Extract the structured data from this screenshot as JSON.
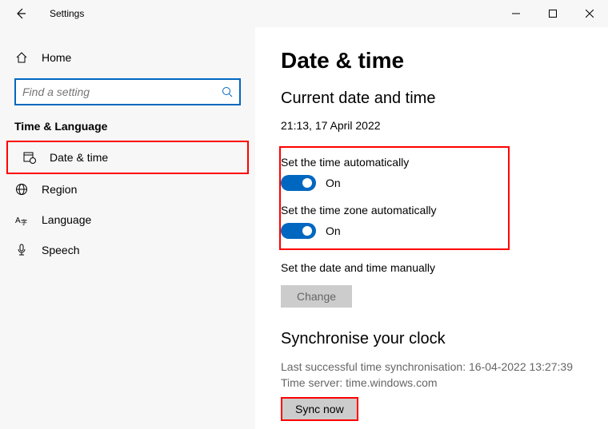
{
  "window": {
    "title": "Settings"
  },
  "sidebar": {
    "home": "Home",
    "search_placeholder": "Find a setting",
    "category": "Time & Language",
    "items": [
      {
        "label": "Date & time"
      },
      {
        "label": "Region"
      },
      {
        "label": "Language"
      },
      {
        "label": "Speech"
      }
    ]
  },
  "page": {
    "title": "Date & time",
    "subtitle": "Current date and time",
    "current": "21:13, 17 April 2022",
    "auto_time_label": "Set the time automatically",
    "auto_time_state": "On",
    "auto_tz_label": "Set the time zone automatically",
    "auto_tz_state": "On",
    "manual_label": "Set the date and time manually",
    "change_btn": "Change",
    "sync_title": "Synchronise your clock",
    "sync_last": "Last successful time synchronisation: 16-04-2022 13:27:39",
    "sync_server": "Time server: time.windows.com",
    "sync_btn": "Sync now"
  }
}
